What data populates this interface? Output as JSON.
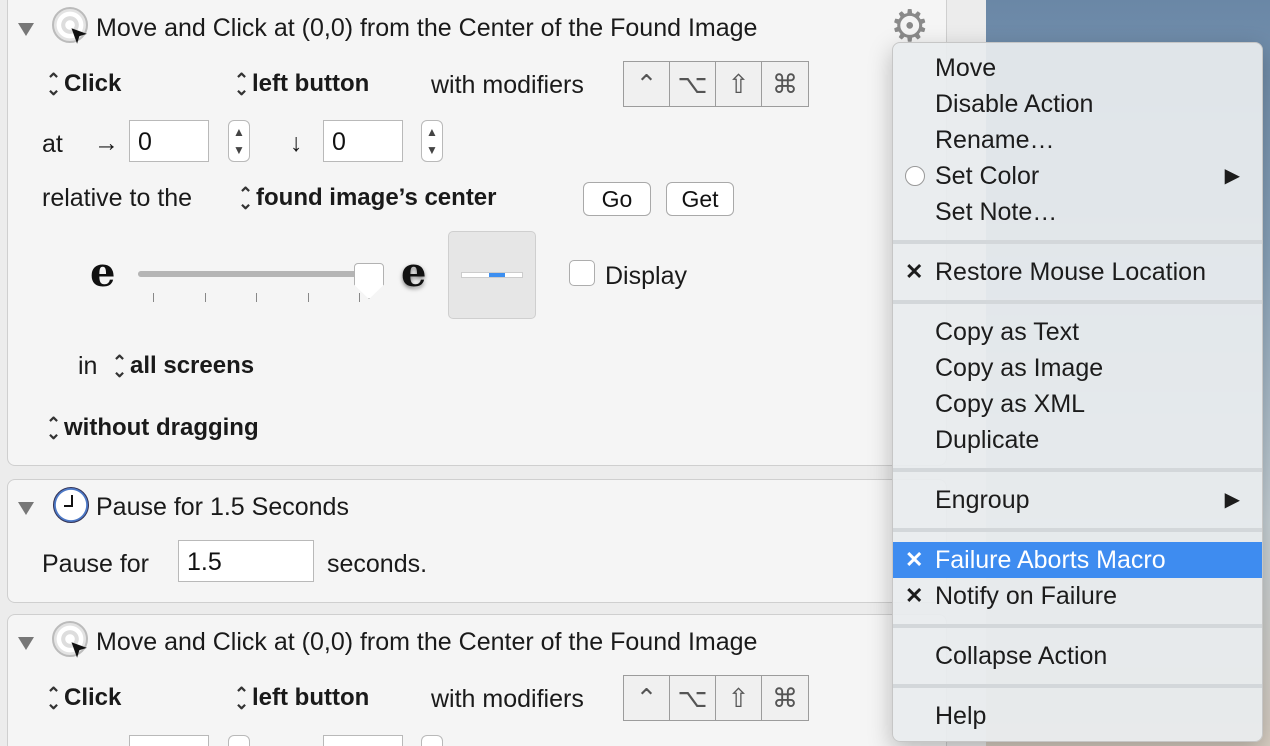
{
  "actions": [
    {
      "title": "Move and Click at (0,0) from the Center of the Found Image",
      "click_type": "Click",
      "button": "left button",
      "with_modifiers": "with modifiers",
      "modifiers": [
        "⌃",
        "⌥",
        "⇧",
        "⌘"
      ],
      "at_label": "at",
      "x_arrow": "→",
      "x_value": "0",
      "y_arrow": "↓",
      "y_value": "0",
      "relative_label": "relative to the",
      "relative_to": "found image’s center",
      "go_label": "Go",
      "get_label": "Get",
      "fuzz_low": "e",
      "fuzz_high": "e",
      "fuzz_level": 1.0,
      "display_label": "Display",
      "display_checked": false,
      "in_label": "in",
      "screens": "all screens",
      "drag_mode": "without dragging"
    },
    {
      "title": "Pause for 1.5 Seconds",
      "pause_label": "Pause for",
      "pause_value": "1.5",
      "seconds_label": "seconds."
    },
    {
      "title": "Move and Click at (0,0) from the Center of the Found Image",
      "click_type": "Click",
      "button": "left button",
      "with_modifiers": "with modifiers",
      "modifiers": [
        "⌃",
        "⌥",
        "⇧",
        "⌘"
      ]
    }
  ],
  "context_menu": {
    "items": [
      {
        "label": "Move"
      },
      {
        "label": "Disable Action"
      },
      {
        "label": "Rename…"
      },
      {
        "label": "Set Color",
        "submenu": "▶"
      },
      {
        "label": "Set Note…"
      },
      {
        "label": "Restore Mouse Location",
        "mark": "✕"
      },
      {
        "label": "Copy as Text"
      },
      {
        "label": "Copy as Image"
      },
      {
        "label": "Copy as XML"
      },
      {
        "label": "Duplicate"
      },
      {
        "label": "Engroup",
        "submenu": "▶"
      },
      {
        "label": "Failure Aborts Macro",
        "mark": "✕",
        "highlighted": true
      },
      {
        "label": "Notify on Failure",
        "mark": "✕"
      },
      {
        "label": "Collapse Action"
      },
      {
        "label": "Help"
      }
    ]
  },
  "colors": {
    "highlight": "#3e8cf0",
    "panel_bg": "#f5f5f5"
  }
}
